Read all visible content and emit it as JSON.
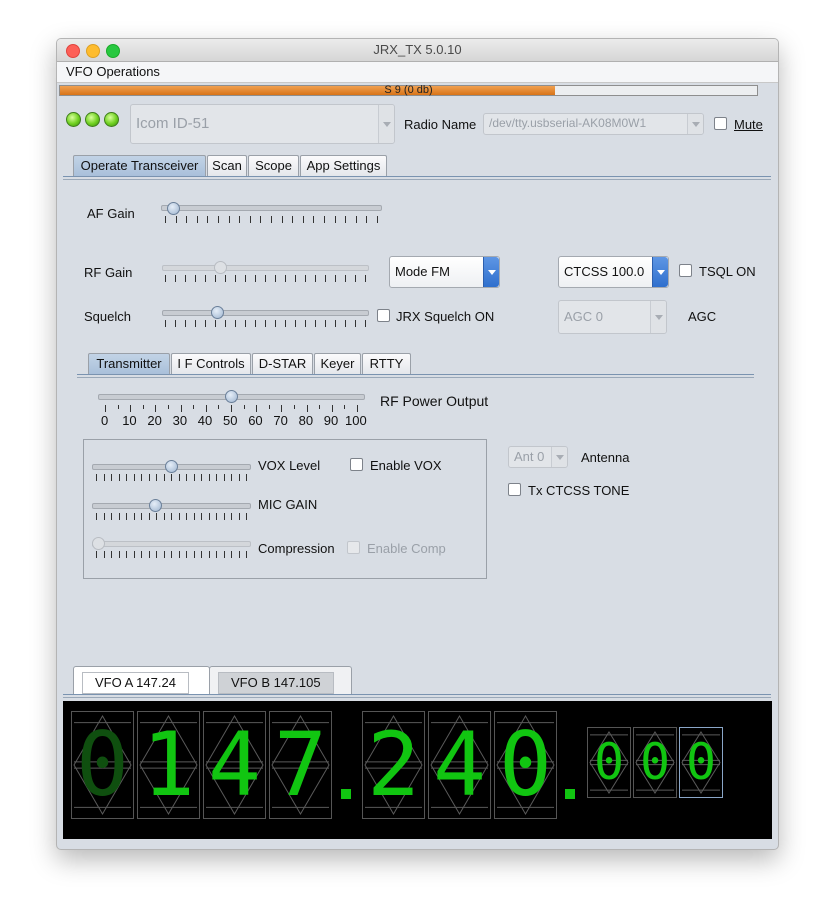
{
  "window": {
    "title": "JRX_TX 5.0.10"
  },
  "menu": {
    "vfo_operations": "VFO Operations"
  },
  "smeter": {
    "text": "S 9 (0 db)",
    "level": 0.71,
    "color": "#e58526"
  },
  "header": {
    "radio_model": "Icom ID-51",
    "radio_name_label": "Radio Name",
    "radio_device": "/dev/tty.usbserial-AK08M0W1",
    "mute_label": "Mute",
    "mute_checked": false
  },
  "main_tabs": [
    "Operate Transceiver",
    "Scan",
    "Scope",
    "App Settings"
  ],
  "operate": {
    "af_gain_label": "AF Gain",
    "af_gain_value": 0.03,
    "rf_gain_label": "RF Gain",
    "rf_gain_value": 0.27,
    "squelch_label": "Squelch",
    "squelch_value": 0.25,
    "mode_value": "Mode FM",
    "ctcss_value": "CTCSS 100.0",
    "tsql_label": "TSQL ON",
    "jrx_squelch_label": "JRX Squelch ON",
    "agc_value": "AGC 0",
    "agc_label": "AGC"
  },
  "sub_tabs": [
    "Transmitter",
    "I F Controls",
    "D-STAR",
    "Keyer",
    "RTTY"
  ],
  "transmitter": {
    "rf_power_label": "RF Power Output",
    "rf_power_value": 50,
    "rf_power_ticks": [
      "0",
      "10",
      "20",
      "30",
      "40",
      "50",
      "60",
      "70",
      "80",
      "90",
      "100"
    ],
    "vox_level_label": "VOX Level",
    "vox_level_value": 0.5,
    "enable_vox_label": "Enable VOX",
    "mic_gain_label": "MIC GAIN",
    "mic_gain_value": 0.39,
    "compression_label": "Compression",
    "compression_value": 0.0,
    "enable_comp_label": "Enable Comp",
    "antenna_value": "Ant 0",
    "antenna_label": "Antenna",
    "tx_ctcss_label": "Tx CTCSS TONE"
  },
  "vfo": {
    "tab_a": "VFO A   147.24",
    "tab_b": "VFO B   147.105",
    "display_digits": [
      "0",
      "1",
      "4",
      "7",
      "2",
      "4",
      "0",
      "0",
      "0",
      "0"
    ],
    "digit_color": "#11c511"
  }
}
